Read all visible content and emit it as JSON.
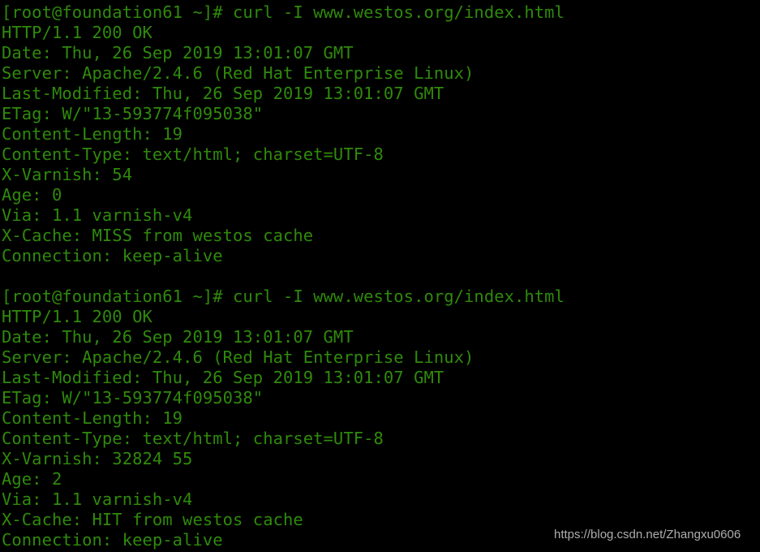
{
  "terminal": {
    "background_color": "#000000",
    "text_color": "#2f8a0b",
    "lines": [
      {
        "id": "prompt-1",
        "text": "[root@foundation61 ~]# curl -I www.westos.org/index.html"
      },
      {
        "id": "status-1",
        "text": "HTTP/1.1 200 OK"
      },
      {
        "id": "date-1",
        "text": "Date: Thu, 26 Sep 2019 13:01:07 GMT"
      },
      {
        "id": "server-1",
        "text": "Server: Apache/2.4.6 (Red Hat Enterprise Linux)"
      },
      {
        "id": "lastmod-1",
        "text": "Last-Modified: Thu, 26 Sep 2019 13:01:07 GMT"
      },
      {
        "id": "etag-1",
        "text": "ETag: W/\"13-593774f095038\""
      },
      {
        "id": "clen-1",
        "text": "Content-Length: 19"
      },
      {
        "id": "ctype-1",
        "text": "Content-Type: text/html; charset=UTF-8"
      },
      {
        "id": "varnish-1",
        "text": "X-Varnish: 54"
      },
      {
        "id": "age-1",
        "text": "Age: 0"
      },
      {
        "id": "via-1",
        "text": "Via: 1.1 varnish-v4"
      },
      {
        "id": "xcache-1",
        "text": "X-Cache: MISS from westos cache"
      },
      {
        "id": "conn-1",
        "text": "Connection: keep-alive"
      },
      {
        "id": "blank-1",
        "text": ""
      },
      {
        "id": "prompt-2",
        "text": "[root@foundation61 ~]# curl -I www.westos.org/index.html"
      },
      {
        "id": "status-2",
        "text": "HTTP/1.1 200 OK"
      },
      {
        "id": "date-2",
        "text": "Date: Thu, 26 Sep 2019 13:01:07 GMT"
      },
      {
        "id": "server-2",
        "text": "Server: Apache/2.4.6 (Red Hat Enterprise Linux)"
      },
      {
        "id": "lastmod-2",
        "text": "Last-Modified: Thu, 26 Sep 2019 13:01:07 GMT"
      },
      {
        "id": "etag-2",
        "text": "ETag: W/\"13-593774f095038\""
      },
      {
        "id": "clen-2",
        "text": "Content-Length: 19"
      },
      {
        "id": "ctype-2",
        "text": "Content-Type: text/html; charset=UTF-8"
      },
      {
        "id": "varnish-2",
        "text": "X-Varnish: 32824 55"
      },
      {
        "id": "age-2",
        "text": "Age: 2"
      },
      {
        "id": "via-2",
        "text": "Via: 1.1 varnish-v4"
      },
      {
        "id": "xcache-2",
        "text": "X-Cache: HIT from westos cache"
      },
      {
        "id": "conn-2",
        "text": "Connection: keep-alive"
      }
    ]
  },
  "watermark": {
    "text": "https://blog.csdn.net/Zhangxu0606",
    "color": "#bdbdbd"
  }
}
